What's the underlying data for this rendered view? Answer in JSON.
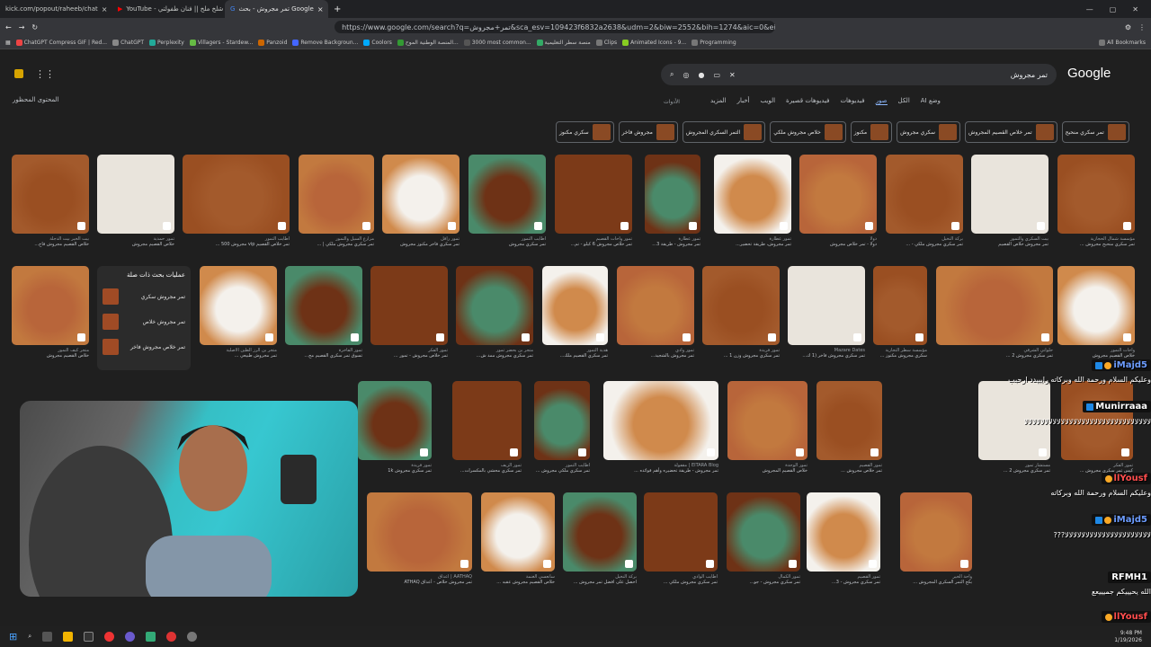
{
  "browser": {
    "tabs": [
      {
        "title": "kick.com/popout/raheeb/chat"
      },
      {
        "title": "YouTube - هدنده شلخ ملخ || فنان طفولتي"
      },
      {
        "title": "تمر مجروش - بحث Google",
        "active": true
      }
    ],
    "url": "https://www.google.com/search?q=تمر+مجروش&sca_esv=109423f6832a2638&udm=2&biw=2552&bih=1274&aic=0&ei=0HtuaZjbNPiB9u8PjLmQs...",
    "bookmarks": [
      "ChatGPT Compress GIF | Red...",
      "ChatGPT",
      "Perplexity",
      "Villagers - Stardew...",
      "Panzoid",
      "Remove Backgroun...",
      "Coolors",
      "المنصة الوطنية الموح...",
      "3000 most common...",
      "منصة سطر التعليمية",
      "Clips",
      "Animated Icons - 9...",
      "Programming",
      "All Bookmarks"
    ]
  },
  "google": {
    "logo": "Google",
    "query": "تمر مجروش",
    "filters": [
      "وضع AI",
      "الكل",
      "صور",
      "فيديوهات",
      "فيديوهات قصيرة",
      "الويب",
      "أخبار",
      "المزيد"
    ],
    "tools": "الأدوات",
    "safe_search": "المحتوى المحظور",
    "chips": [
      "تمر سكري منحبح",
      "تمر خلاص القصيم المجروش",
      "سكري مجروش",
      "مكنوز",
      "خلاص مجروش ملكي",
      "التمر السكري المجروش",
      "مجروش فاخر",
      "سكري مكنوز"
    ],
    "related": {
      "title": "عمليات بحث ذات صلة",
      "items": [
        "تمر مجروش سكري",
        "تمر مجروش خلاص",
        "تمر خلاص مجروش فاخر"
      ]
    },
    "row1_captions": [
      {
        "src": "بيت الخير بيت الدجلة",
        "title": "خلاص القصيم مجروش فاخ..."
      },
      {
        "src": "تمور حمدية",
        "title": "خلاص القصيم مجروش"
      },
      {
        "src": "أطايب التمور",
        "title": "تمر خلاص القصيم vip مجروش 500 ..."
      },
      {
        "src": "مزارع السيل والتمور",
        "title": "تمر سكري مجروش ملكي | ..."
      },
      {
        "src": "تمور رافل",
        "title": "تمر سكري فاخر مكنوز مجروش"
      },
      {
        "src": "أطايب التمور",
        "title": "تمر سكري مجروش"
      },
      {
        "src": "تمور واحات القصيم",
        "title": "تمر خلاص مجروش 6 كيلو - تم..."
      },
      {
        "src": "تمور عطارة",
        "title": "تمر مجروش - طريقة 3..."
      },
      {
        "src": "تمور عطارة",
        "title": "تمر مجروش، طريقة تحضير..."
      },
      {
        "src": "دولا",
        "title": "دولا - تمر خلاص مجروش"
      },
      {
        "src": "بركة النخيل",
        "title": "تمر سكري مجروش ملكي - ..."
      },
      {
        "src": "بيت السكري والتمور",
        "title": "تمر مجروش خلاص القصيم"
      },
      {
        "src": "مؤسسة شمال الحجازية",
        "title": "تمر سكري منحبح مجروش ..."
      }
    ],
    "row2_captions": [
      {
        "src": "متجر كيف التمور",
        "title": "خلاص القصيم مجروش"
      },
      {
        "src": "متجر بن الرز الطين الأصلية",
        "title": "تمر مجروش طبيعي ..."
      },
      {
        "src": "تمور الفاخرة",
        "title": "تسوق تمر سكري القصيم مج..."
      },
      {
        "src": "تمور الفكر",
        "title": "تمر خلاص مجروش - تمور ..."
      },
      {
        "src": "متجر بن بحضر تمور",
        "title": "تمر سكري مجروش ممد ش..."
      },
      {
        "src": "هدية التمور",
        "title": "تمر سكري القصيم ملك..."
      },
      {
        "src": "تمور وادي",
        "title": "تمر مجروش بالشجيد..."
      },
      {
        "src": "تمور فريدة",
        "title": "تمر سكري مجروش وزن 1 ..."
      },
      {
        "src": "Mazare Dates",
        "title": "تمر سكري مجروش فاخر (1 ك..."
      },
      {
        "src": "مؤسسة سطر التجارية",
        "title": "سكري مجروش مكنوز ..."
      },
      {
        "src": "حلواني الشرقي",
        "title": "تمر سكري مجروش 2 ..."
      },
      {
        "src": "تمور",
        "title": "خلاص القصيم المجروش مجروش ..."
      },
      {
        "src": "واحات التمور",
        "title": "خلاص القصيم مجروش"
      }
    ],
    "row3_captions": [
      {
        "src": "تمور فريدة",
        "title": "تمر سكري مجروش 1k"
      },
      {
        "src": "تمور الزيف",
        "title": "تمر سكري محشي بالمكسرات..."
      },
      {
        "src": "أطايب التمور",
        "title": "تمر سكري ملكي مجروش ..."
      },
      {
        "src": "EITARA Blog | مقفولة",
        "title": "تمر مجروش - طريقة تحضيره وأهم فوائده ..."
      },
      {
        "src": "تمور الوجدة",
        "title": "خلاص القصيم المجروش"
      },
      {
        "src": "تمور القصيم",
        "title": "تمر خلاص مجروش ..."
      },
      {
        "src": "مستشار تمور",
        "title": "تمر سكري مجروش 2 ..."
      },
      {
        "src": "تمور الفكر",
        "title": "كيس تمر سكري مجروش ..."
      }
    ],
    "row4_captions": [
      {
        "src": "AATHAQ | أعذاق",
        "title": "تمر مجروش خلاص - أعذاق ATHAQ"
      },
      {
        "src": "سانعسي الغنمة",
        "title": "خلاص القصيم مجروش عقبه ..."
      },
      {
        "src": "بركة النخيل",
        "title": "احصل على افضل تمر مجروش ..."
      },
      {
        "src": "أطايب الوادي",
        "title": "تمر سكري مجروش ملكي ..."
      },
      {
        "src": "تمور الكمال",
        "title": "تمر سكري مجروش - جو..."
      },
      {
        "src": "تمور القصيم",
        "title": "تمر سكري مجروش - 3..."
      },
      {
        "src": "واحة الخير",
        "title": "بكج التمر السكري المجروش ..."
      }
    ]
  },
  "chat": {
    "messages": [
      {
        "user": "iMajd5",
        "text": "وعليكم السلام ورحمة الله وبركاته رايبيدد ارحبب"
      },
      {
        "user": "Munirraaa",
        "text": "ﻻﻻﻻﻻﻻﻻﻻﻻﻻﻻﻻﻻﻻﻻﻻﻻﻻﻻﻻﻻﻻﻻﻻﻻﻻﻻﻻﻻﻻﻻﻻ"
      },
      {
        "user": "llYousf",
        "text": "وعليكم السلام ورحمة الله وبركاته"
      },
      {
        "user": "iMajd5",
        "text": "ﻻﻻﻻﻻﻻﻻﻻﻻﻻﻻﻻﻻﻻﻻﻻﻻﻻﻻﻻﻻﻻ???"
      },
      {
        "user": "RFMH1",
        "text": "الله يحيييكم جميييعع"
      },
      {
        "user": "llYousf",
        "text": ""
      }
    ]
  },
  "taskbar": {
    "time": "9:48 PM",
    "date": "1/19/2026"
  }
}
